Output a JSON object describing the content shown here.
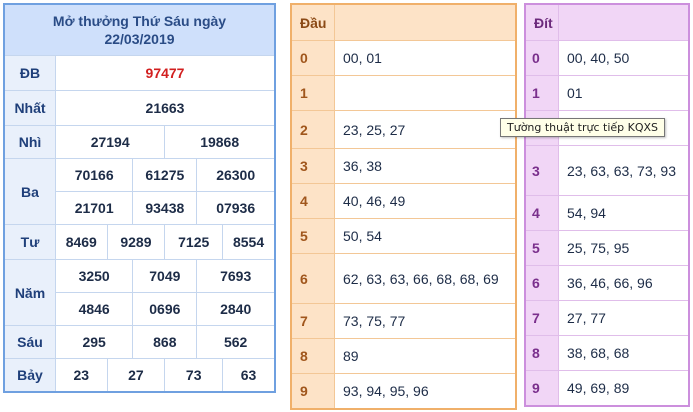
{
  "results": {
    "title_line1": "Mở thưởng Thứ Sáu ngày",
    "title_line2": "22/03/2019",
    "db": {
      "label": "ĐB",
      "value": "97477"
    },
    "nhat": {
      "label": "Nhất",
      "value": "21663"
    },
    "nhi": {
      "label": "Nhì",
      "values": [
        "27194",
        "19868"
      ]
    },
    "ba": {
      "label": "Ba",
      "values": [
        "70166",
        "61275",
        "26300",
        "21701",
        "93438",
        "07936"
      ]
    },
    "tu": {
      "label": "Tư",
      "values": [
        "8469",
        "9289",
        "7125",
        "8554"
      ]
    },
    "nam": {
      "label": "Năm",
      "values": [
        "3250",
        "7049",
        "7693",
        "4846",
        "0696",
        "2840"
      ]
    },
    "sau": {
      "label": "Sáu",
      "values": [
        "295",
        "868",
        "562"
      ]
    },
    "bay": {
      "label": "Bảy",
      "values": [
        "23",
        "27",
        "73",
        "63"
      ]
    }
  },
  "dau": {
    "header": "Đầu",
    "rows": [
      {
        "num": "0",
        "vals": "00, 01"
      },
      {
        "num": "1",
        "vals": ""
      },
      {
        "num": "2",
        "vals": "23, 25, 27"
      },
      {
        "num": "3",
        "vals": "36, 38"
      },
      {
        "num": "4",
        "vals": "40, 46, 49"
      },
      {
        "num": "5",
        "vals": "50, 54"
      },
      {
        "num": "6",
        "vals": "62, 63, 63, 66, 68, 68, 69"
      },
      {
        "num": "7",
        "vals": "73, 75, 77"
      },
      {
        "num": "8",
        "vals": "89"
      },
      {
        "num": "9",
        "vals": "93, 94, 95, 96"
      }
    ]
  },
  "dit": {
    "header": "Đít",
    "rows": [
      {
        "num": "0",
        "vals": "00, 40, 50"
      },
      {
        "num": "1",
        "vals": "01"
      },
      {
        "num": "3",
        "vals": "23, 63, 63, 73, 93"
      },
      {
        "num": "4",
        "vals": "54, 94"
      },
      {
        "num": "5",
        "vals": "25, 75, 95"
      },
      {
        "num": "6",
        "vals": "36, 46, 66, 96"
      },
      {
        "num": "7",
        "vals": "27, 77"
      },
      {
        "num": "8",
        "vals": "38, 68, 68"
      },
      {
        "num": "9",
        "vals": "49, 69, 89"
      }
    ]
  },
  "tooltip": "Tường thuật trực tiếp KQXS",
  "colors": {
    "results_accent": "#6fa0e0",
    "special_prize": "#d21f1f",
    "dau_accent": "#f0b06a",
    "dit_accent": "#cc8fdd"
  }
}
